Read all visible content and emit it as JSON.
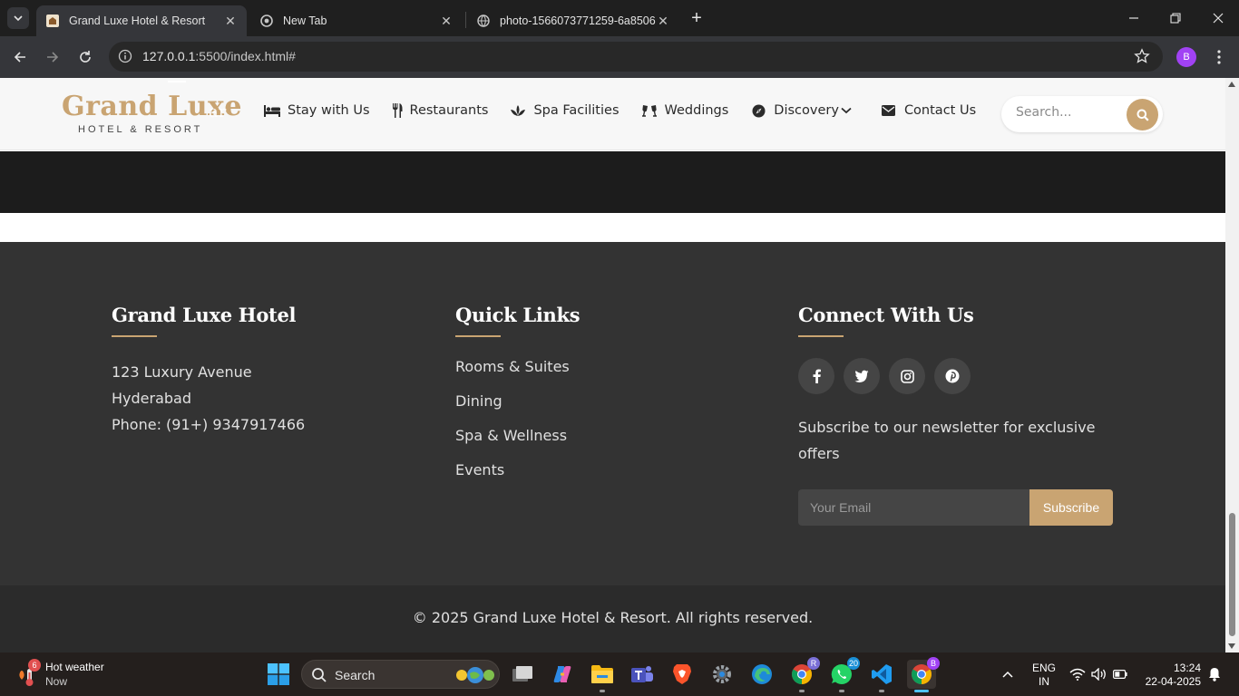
{
  "browser": {
    "tabs": [
      {
        "title": "Grand Luxe Hotel & Resort",
        "active": true
      },
      {
        "title": "New Tab",
        "active": false
      },
      {
        "title": "photo-1566073771259-6a8506",
        "active": false
      }
    ],
    "url_host": "127.0.0.1",
    "url_rest": ":5500/index.html#",
    "profile_initial": "B"
  },
  "site": {
    "logo_title": "Grand Luxe",
    "logo_subtitle": "HOTEL & RESORT",
    "ghost_text": "ar",
    "nav": [
      {
        "label": "Stay with Us",
        "icon": "bed-icon"
      },
      {
        "label": "Restaurants",
        "icon": "utensils-icon"
      },
      {
        "label": "Spa Facilities",
        "icon": "spa-icon"
      },
      {
        "label": "Weddings",
        "icon": "glasses-icon"
      },
      {
        "label": "Discovery",
        "icon": "compass-icon"
      },
      {
        "label": "Contact Us",
        "icon": "envelope-icon"
      }
    ],
    "search_placeholder": "Search...",
    "accent_color": "#c9a472"
  },
  "footer": {
    "about": {
      "heading": "Grand Luxe Hotel",
      "address_line1": "123 Luxury Avenue",
      "address_line2": "Hyderabad",
      "phone": "Phone: (91+) 9347917466"
    },
    "quick_links": {
      "heading": "Quick Links",
      "items": [
        "Rooms & Suites",
        "Dining",
        "Spa & Wellness",
        "Events"
      ]
    },
    "connect": {
      "heading": "Connect With Us",
      "socials": [
        "facebook-icon",
        "twitter-icon",
        "instagram-icon",
        "pinterest-icon"
      ],
      "newsletter_text": "Subscribe to our newsletter for exclusive offers",
      "email_placeholder": "Your Email",
      "subscribe_label": "Subscribe"
    },
    "copyright": "© 2025 Grand Luxe Hotel & Resort. All rights reserved."
  },
  "taskbar": {
    "weather_title": "Hot weather",
    "weather_sub": "Now",
    "weather_badge": "6",
    "search_label": "Search",
    "chrome_badge": "R",
    "whatsapp_badge": "20",
    "active_chrome_badge": "B",
    "lang_line1": "ENG",
    "lang_line2": "IN",
    "time": "13:24",
    "date": "22-04-2025"
  }
}
